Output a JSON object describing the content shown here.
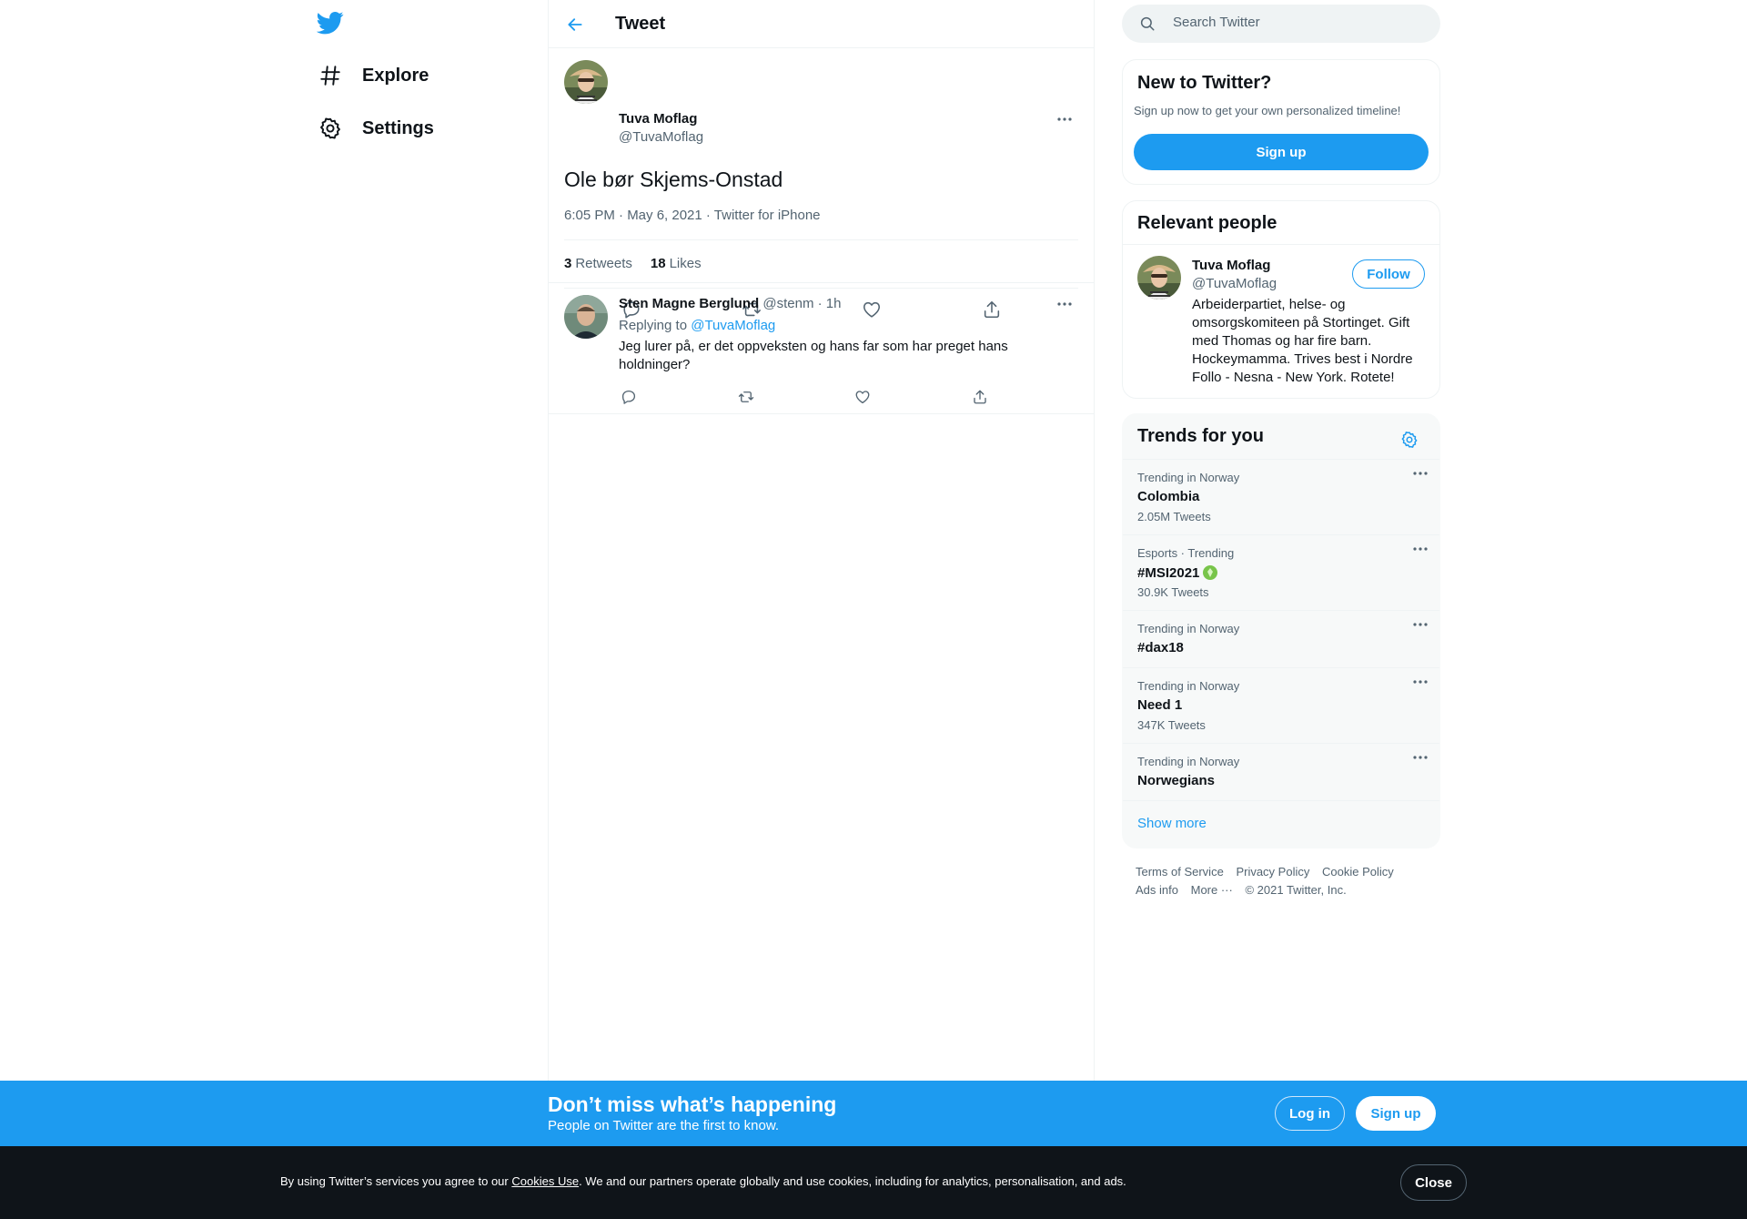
{
  "colors": {
    "brand": "#1d9bf0",
    "text": "#0f1419",
    "muted": "#536471",
    "border": "#eff3f4",
    "dark": "#0f1419"
  },
  "nav": {
    "logo_icon": "twitter-bird-icon",
    "items": [
      {
        "label": "Explore",
        "icon": "hashtag-icon"
      },
      {
        "label": "Settings",
        "icon": "gear-icon"
      }
    ]
  },
  "header": {
    "title": "Tweet",
    "back_icon": "arrow-left-icon"
  },
  "tweet": {
    "author_name": "Tuva Moflag",
    "author_handle": "@TuvaMoflag",
    "text": "Ole bør Skjems-Onstad",
    "meta": "6:05 PM · May 6, 2021 · Twitter for iPhone",
    "retweets_count": "3",
    "retweets_label": "Retweets",
    "likes_count": "18",
    "likes_label": "Likes"
  },
  "reply": {
    "author_name": "Sten Magne Berglund",
    "author_handle": "@stenm",
    "time": "· 1h",
    "replying_prefix": "Replying to",
    "replying_to": "@TuvaMoflag",
    "text": "Jeg lurer på, er det oppveksten og hans far som har preget hans holdninger?"
  },
  "search": {
    "placeholder": "Search Twitter"
  },
  "signup_card": {
    "title": "New to Twitter?",
    "subtitle": "Sign up now to get your own personalized timeline!",
    "button": "Sign up"
  },
  "relevant_people": {
    "title": "Relevant people",
    "person": {
      "name": "Tuva Moflag",
      "handle": "@TuvaMoflag",
      "follow_label": "Follow",
      "bio": "Arbeiderpartiet, helse- og omsorgskomiteen på Stortinget. Gift med Thomas og har fire barn. Hockeymamma. Trives best i Nordre Follo - Nesna - New York. Rotete!"
    }
  },
  "trends": {
    "title": "Trends for you",
    "items": [
      {
        "context": "Trending in Norway",
        "title": "Colombia",
        "count": "2.05M Tweets"
      },
      {
        "context": "Esports · Trending",
        "title": "#MSI2021",
        "count": "30.9K Tweets"
      },
      {
        "context": "Trending in Norway",
        "title": "#dax18",
        "count": ""
      },
      {
        "context": "Trending in Norway",
        "title": "Need 1",
        "count": "347K Tweets"
      },
      {
        "context": "Trending in Norway",
        "title": "Norwegians",
        "count": ""
      }
    ],
    "show_more": "Show more"
  },
  "footer": {
    "terms": "Terms of Service",
    "privacy": "Privacy Policy",
    "cookie": "Cookie Policy",
    "ads": "Ads info",
    "more": "More ···",
    "copyright": "© 2021 Twitter, Inc."
  },
  "promo": {
    "title": "Don’t miss what’s happening",
    "subtitle": "People on Twitter are the first to know.",
    "login": "Log in",
    "signup": "Sign up"
  },
  "cookie_bar": {
    "text_before": "By using Twitter’s services you agree to our ",
    "link": "Cookies Use",
    "text_after": ". We and our partners operate globally and use cookies, including for analytics, personalisation, and ads.",
    "close": "Close"
  }
}
